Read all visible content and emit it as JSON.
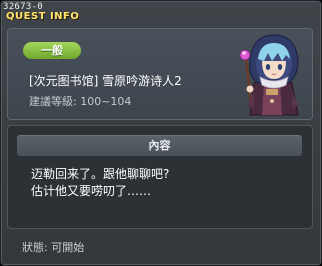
{
  "header": {
    "quest_id": "32673-0",
    "title": "QUEST INFO"
  },
  "quest": {
    "category": "一般",
    "name": "[次元图书馆] 雪原吟游诗人2",
    "level": "建議等級: 100~104"
  },
  "content": {
    "header": "內容",
    "text": "迈勒回来了。跟他聊聊吧?\n估计他又要唠叨了……"
  },
  "status": "狀態: 可開始",
  "colors": {
    "title": "#ffe36a",
    "category_badge": "#8bc444",
    "window_bg": "#3a4045"
  },
  "icons": {
    "close": "close-icon",
    "npc": "npc-portrait"
  }
}
